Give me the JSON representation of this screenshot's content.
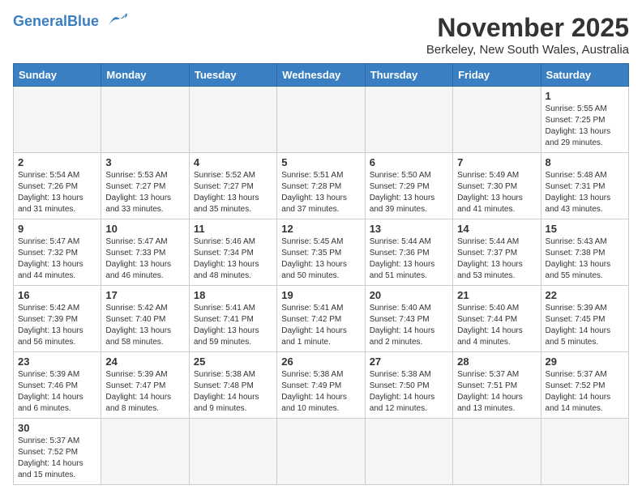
{
  "header": {
    "logo_general": "General",
    "logo_blue": "Blue",
    "month": "November 2025",
    "location": "Berkeley, New South Wales, Australia"
  },
  "weekdays": [
    "Sunday",
    "Monday",
    "Tuesday",
    "Wednesday",
    "Thursday",
    "Friday",
    "Saturday"
  ],
  "weeks": [
    [
      {
        "day": "",
        "info": ""
      },
      {
        "day": "",
        "info": ""
      },
      {
        "day": "",
        "info": ""
      },
      {
        "day": "",
        "info": ""
      },
      {
        "day": "",
        "info": ""
      },
      {
        "day": "",
        "info": ""
      },
      {
        "day": "1",
        "info": "Sunrise: 5:55 AM\nSunset: 7:25 PM\nDaylight: 13 hours\nand 29 minutes."
      }
    ],
    [
      {
        "day": "2",
        "info": "Sunrise: 5:54 AM\nSunset: 7:26 PM\nDaylight: 13 hours\nand 31 minutes."
      },
      {
        "day": "3",
        "info": "Sunrise: 5:53 AM\nSunset: 7:27 PM\nDaylight: 13 hours\nand 33 minutes."
      },
      {
        "day": "4",
        "info": "Sunrise: 5:52 AM\nSunset: 7:27 PM\nDaylight: 13 hours\nand 35 minutes."
      },
      {
        "day": "5",
        "info": "Sunrise: 5:51 AM\nSunset: 7:28 PM\nDaylight: 13 hours\nand 37 minutes."
      },
      {
        "day": "6",
        "info": "Sunrise: 5:50 AM\nSunset: 7:29 PM\nDaylight: 13 hours\nand 39 minutes."
      },
      {
        "day": "7",
        "info": "Sunrise: 5:49 AM\nSunset: 7:30 PM\nDaylight: 13 hours\nand 41 minutes."
      },
      {
        "day": "8",
        "info": "Sunrise: 5:48 AM\nSunset: 7:31 PM\nDaylight: 13 hours\nand 43 minutes."
      }
    ],
    [
      {
        "day": "9",
        "info": "Sunrise: 5:47 AM\nSunset: 7:32 PM\nDaylight: 13 hours\nand 44 minutes."
      },
      {
        "day": "10",
        "info": "Sunrise: 5:47 AM\nSunset: 7:33 PM\nDaylight: 13 hours\nand 46 minutes."
      },
      {
        "day": "11",
        "info": "Sunrise: 5:46 AM\nSunset: 7:34 PM\nDaylight: 13 hours\nand 48 minutes."
      },
      {
        "day": "12",
        "info": "Sunrise: 5:45 AM\nSunset: 7:35 PM\nDaylight: 13 hours\nand 50 minutes."
      },
      {
        "day": "13",
        "info": "Sunrise: 5:44 AM\nSunset: 7:36 PM\nDaylight: 13 hours\nand 51 minutes."
      },
      {
        "day": "14",
        "info": "Sunrise: 5:44 AM\nSunset: 7:37 PM\nDaylight: 13 hours\nand 53 minutes."
      },
      {
        "day": "15",
        "info": "Sunrise: 5:43 AM\nSunset: 7:38 PM\nDaylight: 13 hours\nand 55 minutes."
      }
    ],
    [
      {
        "day": "16",
        "info": "Sunrise: 5:42 AM\nSunset: 7:39 PM\nDaylight: 13 hours\nand 56 minutes."
      },
      {
        "day": "17",
        "info": "Sunrise: 5:42 AM\nSunset: 7:40 PM\nDaylight: 13 hours\nand 58 minutes."
      },
      {
        "day": "18",
        "info": "Sunrise: 5:41 AM\nSunset: 7:41 PM\nDaylight: 13 hours\nand 59 minutes."
      },
      {
        "day": "19",
        "info": "Sunrise: 5:41 AM\nSunset: 7:42 PM\nDaylight: 14 hours\nand 1 minute."
      },
      {
        "day": "20",
        "info": "Sunrise: 5:40 AM\nSunset: 7:43 PM\nDaylight: 14 hours\nand 2 minutes."
      },
      {
        "day": "21",
        "info": "Sunrise: 5:40 AM\nSunset: 7:44 PM\nDaylight: 14 hours\nand 4 minutes."
      },
      {
        "day": "22",
        "info": "Sunrise: 5:39 AM\nSunset: 7:45 PM\nDaylight: 14 hours\nand 5 minutes."
      }
    ],
    [
      {
        "day": "23",
        "info": "Sunrise: 5:39 AM\nSunset: 7:46 PM\nDaylight: 14 hours\nand 6 minutes."
      },
      {
        "day": "24",
        "info": "Sunrise: 5:39 AM\nSunset: 7:47 PM\nDaylight: 14 hours\nand 8 minutes."
      },
      {
        "day": "25",
        "info": "Sunrise: 5:38 AM\nSunset: 7:48 PM\nDaylight: 14 hours\nand 9 minutes."
      },
      {
        "day": "26",
        "info": "Sunrise: 5:38 AM\nSunset: 7:49 PM\nDaylight: 14 hours\nand 10 minutes."
      },
      {
        "day": "27",
        "info": "Sunrise: 5:38 AM\nSunset: 7:50 PM\nDaylight: 14 hours\nand 12 minutes."
      },
      {
        "day": "28",
        "info": "Sunrise: 5:37 AM\nSunset: 7:51 PM\nDaylight: 14 hours\nand 13 minutes."
      },
      {
        "day": "29",
        "info": "Sunrise: 5:37 AM\nSunset: 7:52 PM\nDaylight: 14 hours\nand 14 minutes."
      }
    ],
    [
      {
        "day": "30",
        "info": "Sunrise: 5:37 AM\nSunset: 7:52 PM\nDaylight: 14 hours\nand 15 minutes."
      },
      {
        "day": "",
        "info": ""
      },
      {
        "day": "",
        "info": ""
      },
      {
        "day": "",
        "info": ""
      },
      {
        "day": "",
        "info": ""
      },
      {
        "day": "",
        "info": ""
      },
      {
        "day": "",
        "info": ""
      }
    ]
  ]
}
